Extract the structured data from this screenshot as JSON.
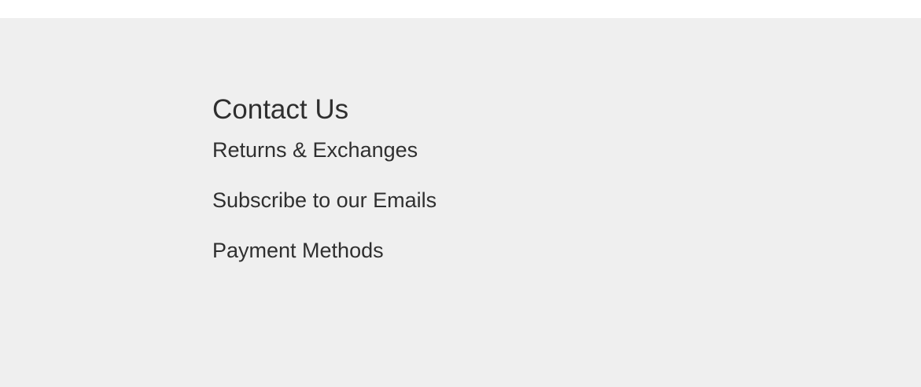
{
  "footer": {
    "links": [
      {
        "label": "Contact Us"
      },
      {
        "label": "Returns & Exchanges"
      },
      {
        "label": "Subscribe to our Emails"
      },
      {
        "label": "Payment Methods"
      }
    ]
  },
  "colors": {
    "panel_background": "#efefef",
    "text": "#2f2f2f"
  }
}
